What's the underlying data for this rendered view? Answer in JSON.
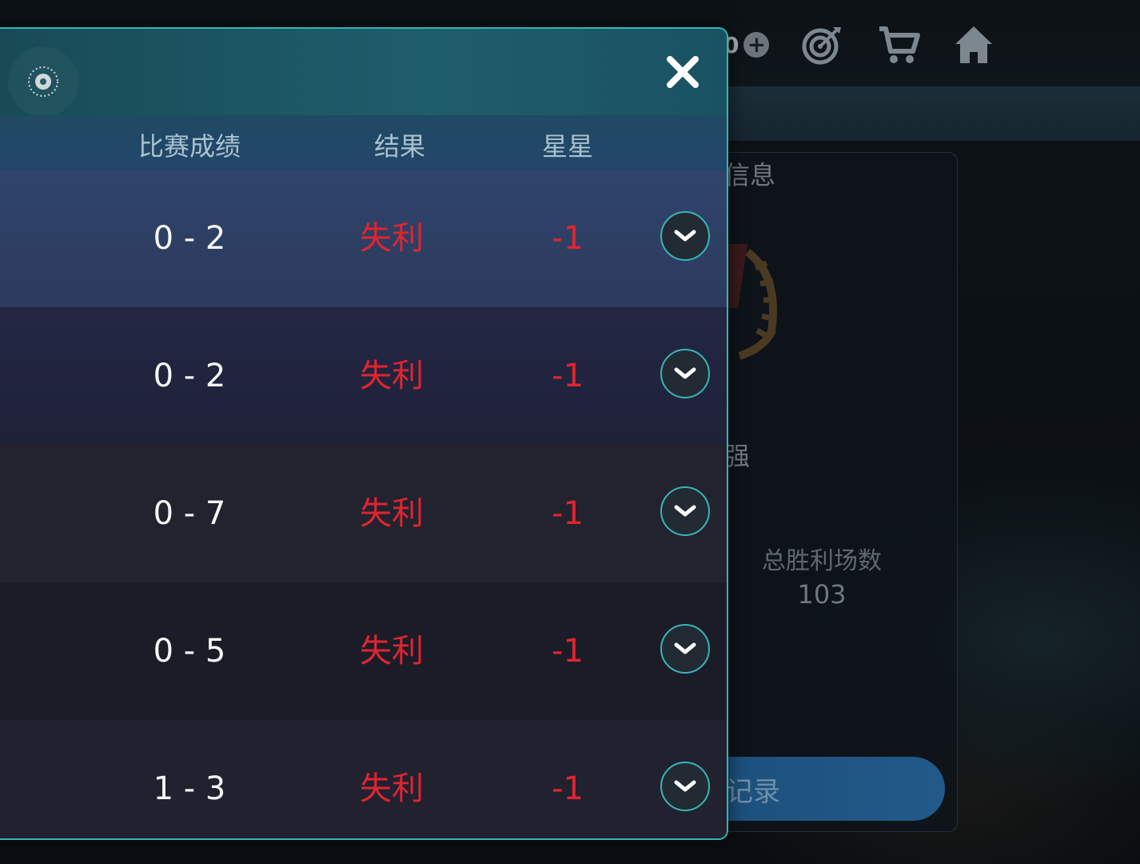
{
  "header": {
    "currency_fragment": "0"
  },
  "background_panel": {
    "title_fragment": "信息",
    "strength_fragment": "强",
    "wins_label": "总胜利场数",
    "wins_value": "103",
    "record_button_fragment": "记录"
  },
  "modal": {
    "columns": {
      "score": "比赛成绩",
      "result": "结果",
      "stars": "星星"
    },
    "rows": [
      {
        "score": "0 - 2",
        "result": "失利",
        "stars": "-1"
      },
      {
        "score": "0 - 2",
        "result": "失利",
        "stars": "-1"
      },
      {
        "score": "0 - 7",
        "result": "失利",
        "stars": "-1"
      },
      {
        "score": "0 - 5",
        "result": "失利",
        "stars": "-1"
      },
      {
        "score": "1 - 3",
        "result": "失利",
        "stars": "-1"
      }
    ]
  },
  "colors": {
    "accent_teal": "#2fb7b3",
    "loss_red": "#e0252f"
  },
  "icons": [
    "settings-icon",
    "close-icon",
    "chevron-down-icon",
    "plus-icon",
    "target-icon",
    "cart-icon",
    "home-icon",
    "laurel-badge-icon"
  ]
}
